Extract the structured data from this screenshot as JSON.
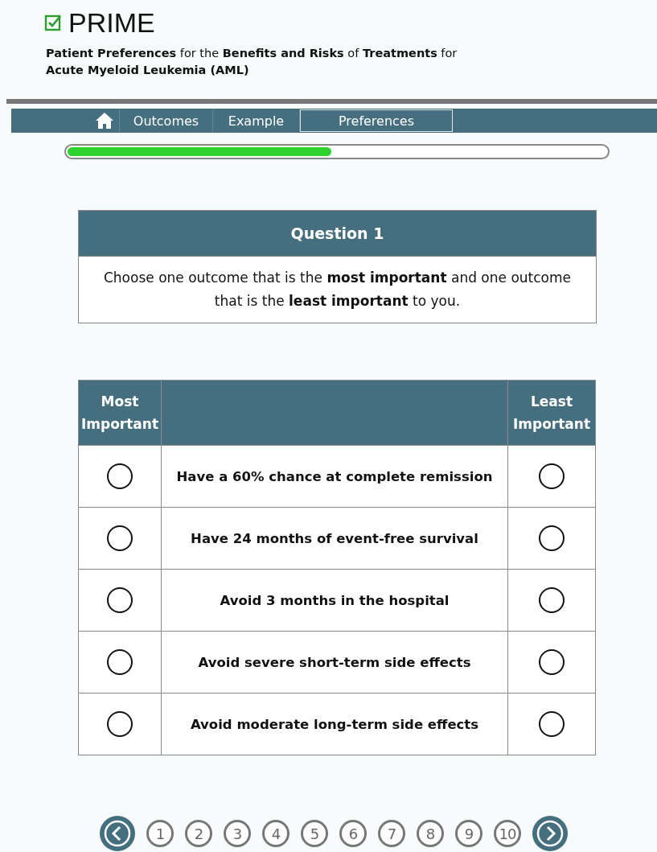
{
  "logo": {
    "name": "PRIME"
  },
  "subtitle": "**Patient Preferences** for the **Benefits and Risks** of **Treatments** for\n**Acute Myeloid Leukemia (AML)**",
  "tabs": [
    {
      "label": "Outcomes",
      "selected": false
    },
    {
      "label": "Example",
      "selected": false
    },
    {
      "label": "Preferences",
      "selected": true
    }
  ],
  "progress": {
    "level": 0.49
  },
  "question": {
    "title": "Question 1",
    "text": "Choose one outcome that is the **most important** and one outcome that is the **least important** to you."
  },
  "table": {
    "columns": [
      "Most Important",
      "Least Important"
    ],
    "rows": [
      {
        "outcome": "Have a 60% chance at complete remission",
        "most": false,
        "least": false
      },
      {
        "outcome": "Have 24 months of event-free survival",
        "most": false,
        "least": false
      },
      {
        "outcome": "Avoid 3 months in the hospital",
        "most": false,
        "least": false
      },
      {
        "outcome": "Avoid severe short-term side effects",
        "most": false,
        "least": false
      },
      {
        "outcome": "Avoid moderate long-term side effects",
        "most": false,
        "least": false
      }
    ]
  },
  "pages": [
    "1",
    "2",
    "3",
    "4",
    "5",
    "6",
    "7",
    "8",
    "9",
    "10"
  ]
}
